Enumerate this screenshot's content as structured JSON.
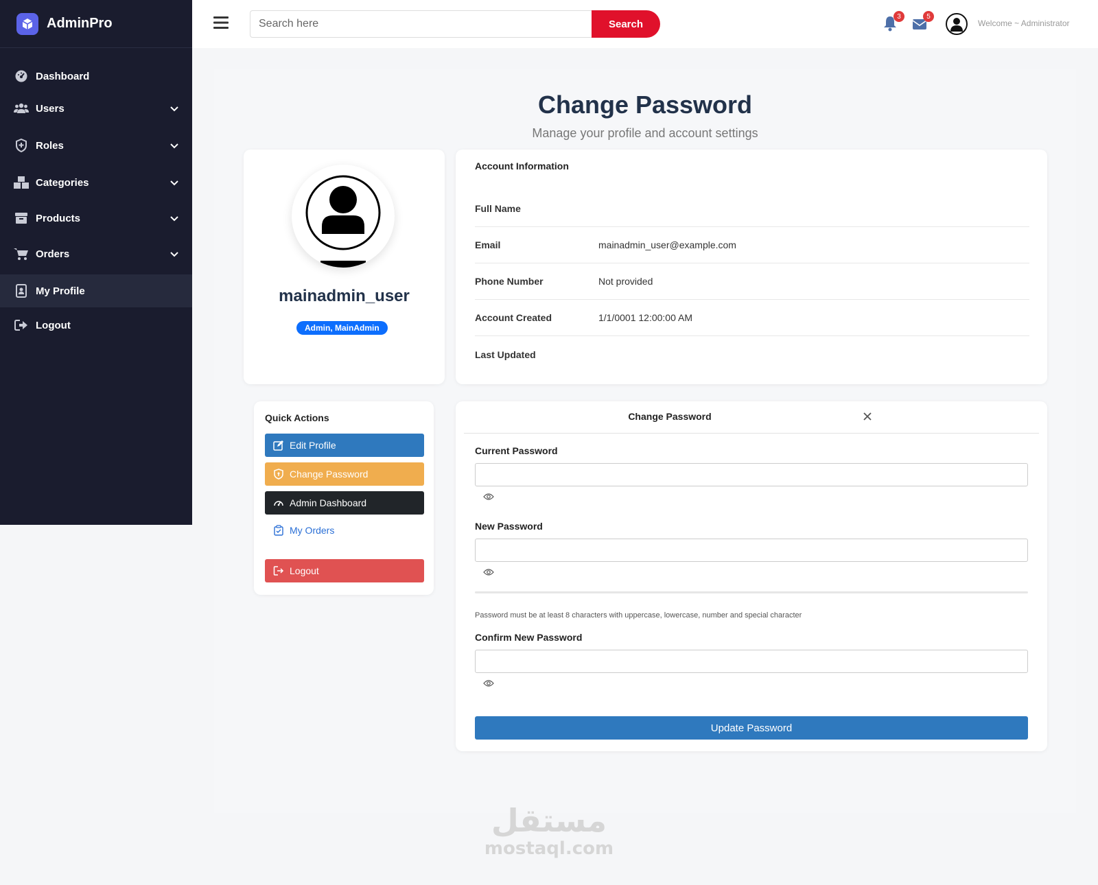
{
  "brand": {
    "name": "AdminPro",
    "accent": "#5b63e8"
  },
  "sidebar": {
    "items": [
      {
        "label": "Dashboard",
        "icon": "gauge-icon",
        "dropdown": false,
        "active": false
      },
      {
        "label": "Users",
        "icon": "users-icon",
        "dropdown": true,
        "active": false
      },
      {
        "label": "Roles",
        "icon": "shield-icon",
        "dropdown": true,
        "active": false
      },
      {
        "label": "Categories",
        "icon": "boxes-icon",
        "dropdown": true,
        "active": false
      },
      {
        "label": "Products",
        "icon": "box-icon",
        "dropdown": true,
        "active": false
      },
      {
        "label": "Orders",
        "icon": "cart-icon",
        "dropdown": true,
        "active": false
      },
      {
        "label": "My Profile",
        "icon": "id-badge-icon",
        "dropdown": false,
        "active": true
      },
      {
        "label": "Logout",
        "icon": "logout-icon",
        "dropdown": false,
        "active": false
      }
    ]
  },
  "topbar": {
    "search_placeholder": "Search here",
    "search_label": "Search",
    "notifications_count": "3",
    "messages_count": "5",
    "welcome": "Welcome ~ Administrator"
  },
  "page": {
    "title": "Change Password",
    "subtitle": "Manage your profile and account settings"
  },
  "profile": {
    "username": "mainadmin_user",
    "roles": "Admin, MainAdmin"
  },
  "account": {
    "title": "Account Information",
    "rows": [
      {
        "label": "Full Name",
        "value": ""
      },
      {
        "label": "Email",
        "value": "mainadmin_user@example.com"
      },
      {
        "label": "Phone Number",
        "value": "Not provided"
      },
      {
        "label": "Account Created",
        "value": "1/1/0001 12:00:00 AM"
      },
      {
        "label": "Last Updated",
        "value": ""
      }
    ]
  },
  "quick_actions": {
    "title": "Quick Actions",
    "edit_profile": "Edit Profile",
    "change_password": "Change Password",
    "admin_dashboard": "Admin Dashboard",
    "my_orders": "My Orders",
    "logout": "Logout"
  },
  "change_password": {
    "title": "Change Password",
    "current_label": "Current Password",
    "current_value": "",
    "new_label": "New Password",
    "new_value": "",
    "hint": "Password must be at least 8 characters with uppercase, lowercase, number and special character",
    "confirm_label": "Confirm New Password",
    "confirm_value": "",
    "submit": "Update Password"
  },
  "watermark": {
    "arabic": "مستقل",
    "latin": "mostaql.com"
  },
  "colors": {
    "sidebar_bg": "#1a1c2e",
    "search_button": "#e0112b",
    "primary": "#2f79be",
    "warning": "#f0ad4e",
    "dark": "#212529",
    "danger": "#e05252",
    "badge": "#0d6efd"
  }
}
